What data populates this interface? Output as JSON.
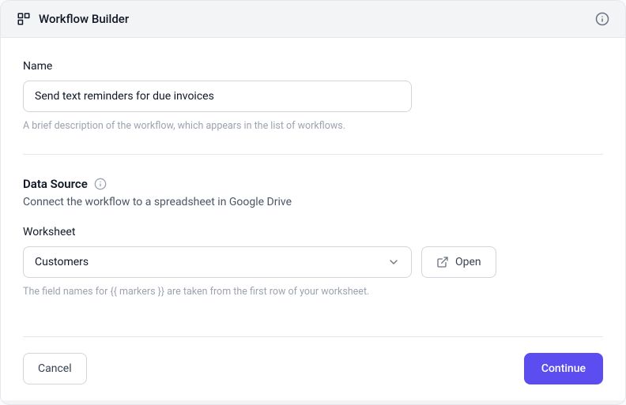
{
  "header": {
    "title": "Workflow Builder"
  },
  "form": {
    "name": {
      "label": "Name",
      "value": "Send text reminders for due invoices",
      "help": "A brief description of the workflow, which appears in the list of workflows."
    },
    "dataSource": {
      "title": "Data Source",
      "desc": "Connect the workflow to a spreadsheet in Google Drive",
      "worksheet": {
        "label": "Worksheet",
        "value": "Customers",
        "help": "The field names for {{ markers }} are taken from the first row of your worksheet."
      },
      "openLabel": "Open"
    }
  },
  "footer": {
    "cancel": "Cancel",
    "continue": "Continue"
  }
}
